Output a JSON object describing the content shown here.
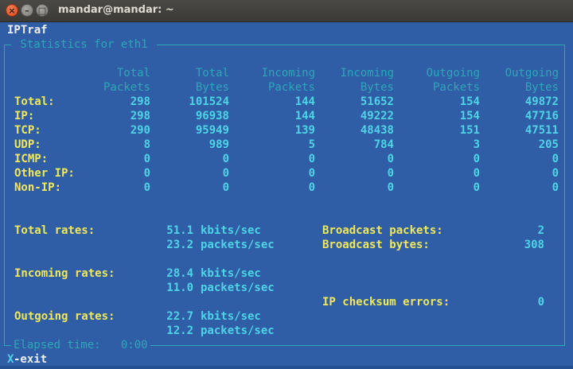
{
  "window": {
    "title": "mandar@mandar: ~",
    "close_glyph": "×",
    "minimize_glyph": "–",
    "maximize_glyph": "□"
  },
  "app": {
    "name": "IPTraf",
    "panel_title": " Statistics for eth1 ",
    "elapsed": "Elapsed time:   0:00",
    "exit_key": "X",
    "exit_label": "-exit"
  },
  "stats_table": {
    "headers": [
      [
        "Total",
        "Packets"
      ],
      [
        "Total",
        "Bytes"
      ],
      [
        "Incoming",
        "Packets"
      ],
      [
        "Incoming",
        "Bytes"
      ],
      [
        "Outgoing",
        "Packets"
      ],
      [
        "Outgoing",
        "Bytes"
      ]
    ],
    "rows": [
      {
        "label": "Total:",
        "values": [
          "298",
          "101524",
          "144",
          "51652",
          "154",
          "49872"
        ]
      },
      {
        "label": "IP:",
        "values": [
          "298",
          "96938",
          "144",
          "49222",
          "154",
          "47716"
        ]
      },
      {
        "label": "TCP:",
        "values": [
          "290",
          "95949",
          "139",
          "48438",
          "151",
          "47511"
        ]
      },
      {
        "label": "UDP:",
        "values": [
          "8",
          "989",
          "5",
          "784",
          "3",
          "205"
        ]
      },
      {
        "label": "ICMP:",
        "values": [
          "0",
          "0",
          "0",
          "0",
          "0",
          "0"
        ]
      },
      {
        "label": "Other IP:",
        "values": [
          "0",
          "0",
          "0",
          "0",
          "0",
          "0"
        ]
      },
      {
        "label": "Non-IP:",
        "values": [
          "0",
          "0",
          "0",
          "0",
          "0",
          "0"
        ]
      }
    ]
  },
  "rates": {
    "total": {
      "label": "Total rates:",
      "kbits": "51.1",
      "packets": "23.2"
    },
    "incoming": {
      "label": "Incoming rates:",
      "kbits": "28.4",
      "packets": "11.0"
    },
    "outgoing": {
      "label": "Outgoing rates:",
      "kbits": "22.7",
      "packets": "12.2"
    },
    "kbits_unit": "kbits/sec",
    "packets_unit": "packets/sec"
  },
  "broadcast": {
    "packets_label": "Broadcast packets:",
    "packets_value": "2",
    "bytes_label": "Broadcast bytes:",
    "bytes_value": "308"
  },
  "checksum": {
    "label": "IP checksum errors:",
    "value": "0"
  },
  "colors": {
    "terminal_bg": "#2f5ea6",
    "label_yellow": "#f0e85a",
    "value_cyan": "#4fd3e6",
    "header_dim": "#2fa6b8"
  }
}
